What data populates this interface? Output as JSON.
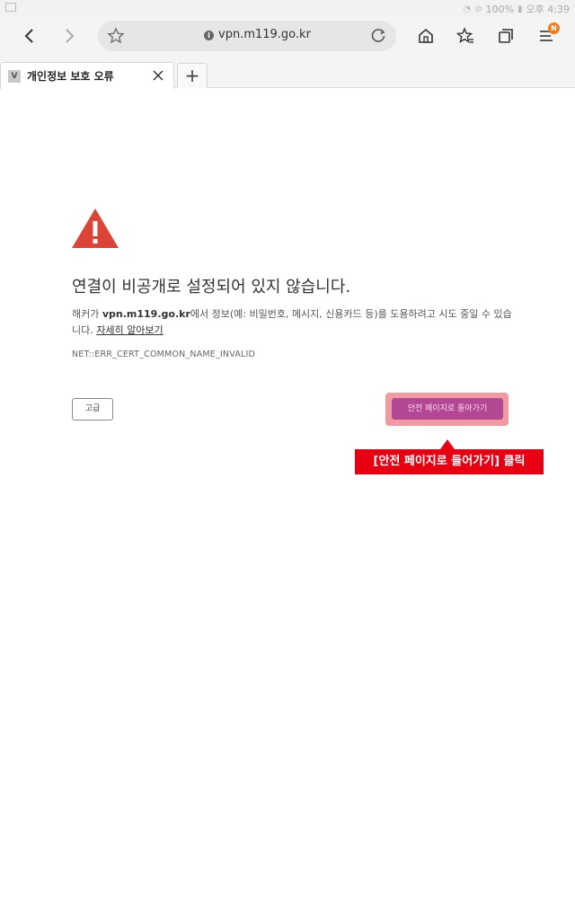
{
  "status_bar": {
    "battery": "100%",
    "time": "오후 4:39"
  },
  "toolbar": {
    "url": "vpn.m119.go.kr",
    "menu_badge": "N"
  },
  "tab": {
    "favicon_letter": "V",
    "title": "개인정보 보호 오류",
    "new_tab": "+"
  },
  "page": {
    "heading": "연결이 비공개로 설정되어 있지 않습니다.",
    "desc_prefix": "해커가 ",
    "desc_host": "vpn.m119.go.kr",
    "desc_suffix": "에서 정보(예: 비밀번호, 메시지, 신용카드 등)를 도용하려고 시도 중일 수 있습니다. ",
    "learn_more": "자세히 알아보기",
    "error_code": "NET::ERR_CERT_COMMON_NAME_INVALID",
    "advanced_button": "고급",
    "back_to_safety_button": "안전 페이지로 돌아가기"
  },
  "annotation": {
    "callout": "[안전 페이지로 들어가기] 클릭",
    "color": "#e60012"
  },
  "colors": {
    "warning_icon": "#db4437",
    "primary_button": "#b24893",
    "highlight": "#f19aa0"
  },
  "icons": [
    "back-icon",
    "forward-icon",
    "star-icon",
    "info-icon",
    "reload-icon",
    "home-icon",
    "bookmarks-icon",
    "tabs-icon",
    "menu-icon",
    "close-icon",
    "warning-icon"
  ]
}
